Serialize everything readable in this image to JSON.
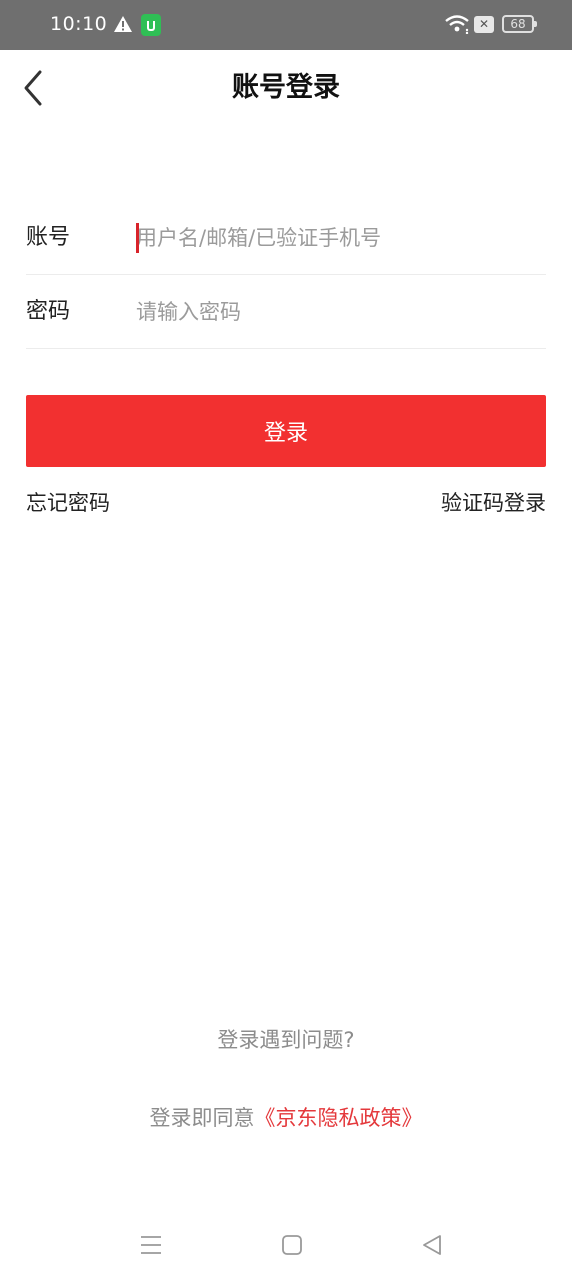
{
  "status_bar": {
    "time": "10:10",
    "battery": "68",
    "icons": [
      "warning-icon",
      "app-notification-icon",
      "wifi-icon",
      "no-sim-icon",
      "battery-icon"
    ]
  },
  "header": {
    "title": "账号登录",
    "back_icon": "chevron-left-icon"
  },
  "form": {
    "account_label": "账号",
    "account_placeholder": "用户名/邮箱/已验证手机号",
    "account_value": "",
    "password_label": "密码",
    "password_placeholder": "请输入密码",
    "password_value": ""
  },
  "actions": {
    "login_label": "登录",
    "forgot_label": "忘记密码",
    "sms_login_label": "验证码登录"
  },
  "footer": {
    "help_label": "登录遇到问题?",
    "agree_prefix": "登录即同意",
    "policy_label": "《京东隐私政策》"
  },
  "colors": {
    "accent": "#f23030",
    "status_bar": "#6f6f6f",
    "policy_link": "#e4393c"
  },
  "system_nav": [
    "menu-icon",
    "home-icon",
    "back-triangle-icon"
  ]
}
